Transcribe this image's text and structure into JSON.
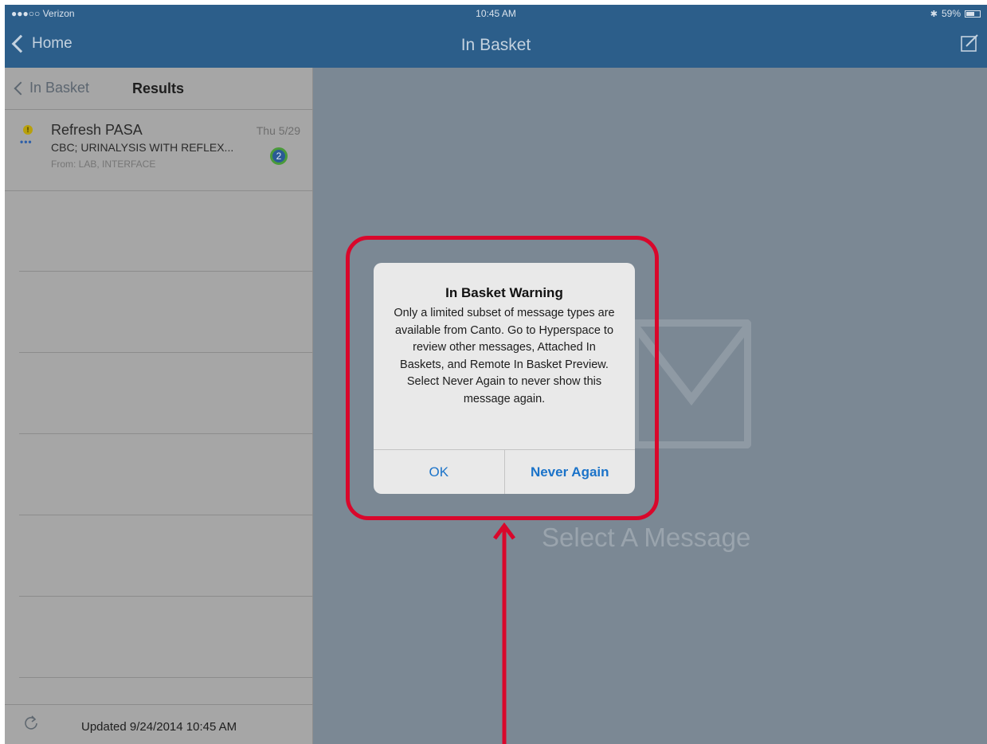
{
  "status_bar": {
    "carrier": "●●●○○ Verizon",
    "time": "10:45 AM",
    "battery": "59%"
  },
  "nav": {
    "back_label": "Home",
    "title": "In Basket",
    "compose_icon": "compose-icon"
  },
  "left_panel": {
    "back_label": "In Basket",
    "title": "Results",
    "message": {
      "title": "Refresh PASA",
      "date": "Thu 5/29",
      "subject": "CBC; URINALYSIS WITH REFLEX...",
      "from": "From: LAB, INTERFACE",
      "count": "2",
      "priority_icon": "!",
      "dots": "•••"
    },
    "footer_text": "Updated 9/24/2014 10:45 AM"
  },
  "right_panel": {
    "placeholder": "Select A Message"
  },
  "alert": {
    "title": "In Basket Warning",
    "body": "Only a limited subset of message types are available from Canto.  Go to Hyperspace to review other messages, Attached In Baskets, and Remote In Basket Preview.  Select Never Again to never show this message again.",
    "ok_label": "OK",
    "never_label": "Never Again"
  },
  "colors": {
    "nav": "#2c5e8a",
    "annotation": "#d9072b",
    "link": "#1b73c9"
  }
}
